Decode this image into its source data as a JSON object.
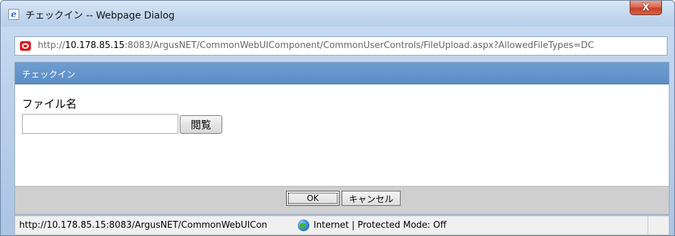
{
  "window": {
    "title": "チェックイン -- Webpage Dialog",
    "close_label": "X"
  },
  "address": {
    "scheme": "http://",
    "host": "10.178.85.15",
    "rest": ":8083/ArgusNET/CommonWebUIComponent/CommonUserControls/FileUpload.aspx?AllowedFileTypes=DC"
  },
  "panel": {
    "title": "チェックイン",
    "file_label": "ファイル名",
    "file_value": "",
    "browse_label": "閲覧"
  },
  "footer": {
    "ok_label": "OK",
    "cancel_label": "キャンセル"
  },
  "status": {
    "url": "http://10.178.85.15:8083/ArgusNET/CommonWebUICon",
    "zone": "Internet | Protected Mode: Off"
  },
  "colors": {
    "panel_header": "#5b8cc5",
    "close_button": "#c6412a",
    "footer_bar": "#cfcfcf"
  },
  "icons": {
    "title": "ie-icon",
    "address": "page-icon",
    "zone": "globe-icon"
  }
}
